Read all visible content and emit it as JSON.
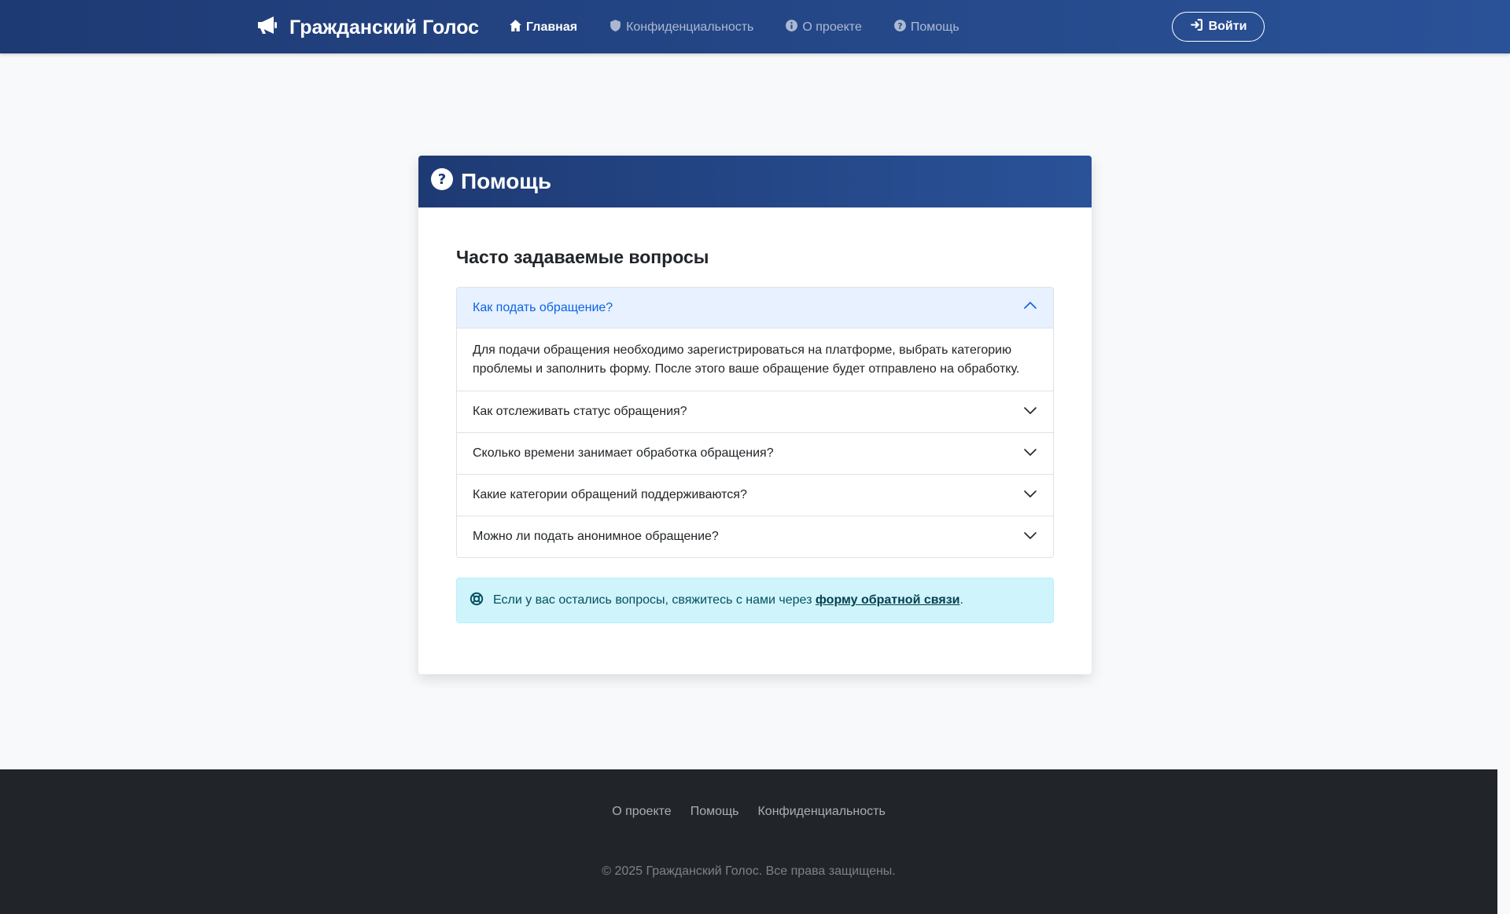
{
  "navbar": {
    "brand": "Гражданский Голос",
    "brand_icon": "megaphone-icon",
    "links": [
      {
        "label": "Главная",
        "icon": "home-icon",
        "active": true
      },
      {
        "label": "Конфиденциальность",
        "icon": "shield-icon",
        "active": false
      },
      {
        "label": "О проекте",
        "icon": "info-icon",
        "active": false
      },
      {
        "label": "Помощь",
        "icon": "question-icon",
        "active": false
      }
    ],
    "login_label": "Войти"
  },
  "card": {
    "title": "Помощь",
    "faq_heading": "Часто задаваемые вопросы",
    "faq": [
      {
        "question": "Как подать обращение?",
        "answer": "Для подачи обращения необходимо зарегистрироваться на платформе, выбрать категорию проблемы и заполнить форму. После этого ваше обращение будет отправлено на обработку.",
        "open": true
      },
      {
        "question": "Как отслеживать статус обращения?",
        "open": false
      },
      {
        "question": "Сколько времени занимает обработка обращения?",
        "open": false
      },
      {
        "question": "Какие категории обращений поддерживаются?",
        "open": false
      },
      {
        "question": "Можно ли подать анонимное обращение?",
        "open": false
      }
    ],
    "alert": {
      "text": "Если у вас остались вопросы, свяжитесь с нами через",
      "link": "форму обратной связи",
      "end": "."
    }
  },
  "footer": {
    "links": [
      "О проекте",
      "Помощь",
      "Конфиденциальность"
    ],
    "copyright": "© 2025 Гражданский Голос. Все права защищены."
  },
  "colors": {
    "primary_dark": "#1e3a74",
    "primary": "#2a5298",
    "accordion_active_bg": "#e7f1ff",
    "accordion_active_text": "#0c63e4",
    "alert_bg": "#cff4fc",
    "footer_bg": "#212529"
  }
}
